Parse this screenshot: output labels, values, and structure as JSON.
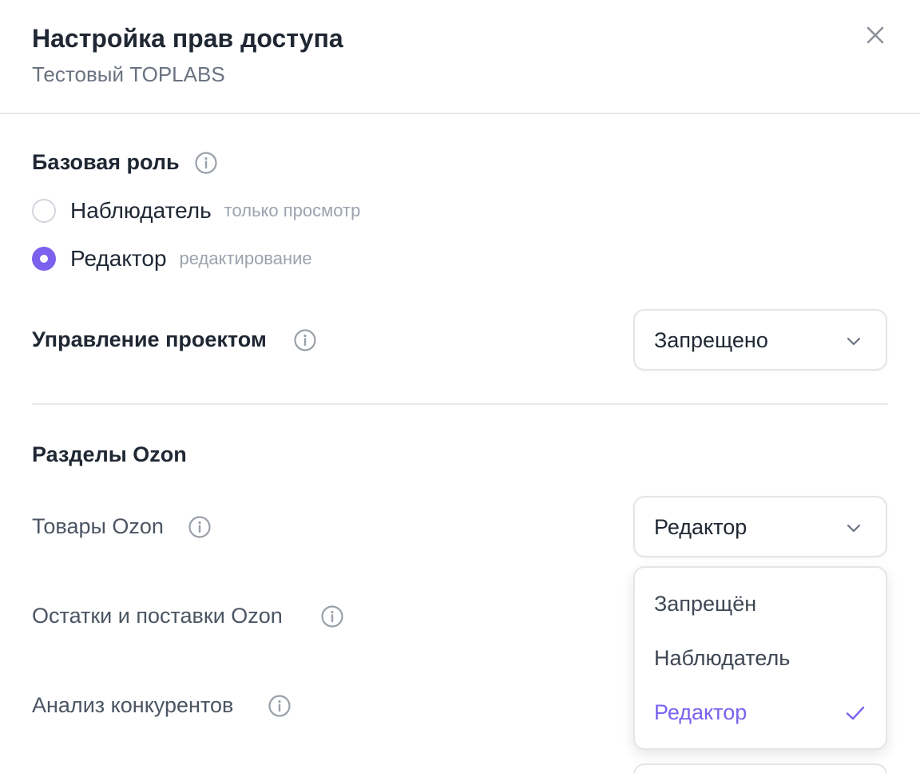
{
  "header": {
    "title": "Настройка прав доступа",
    "subtitle": "Тестовый TOPLABS",
    "close_icon": "close-icon"
  },
  "base_role": {
    "title": "Базовая роль",
    "info_icon": "info-icon",
    "options": [
      {
        "label": "Наблюдатель",
        "hint": "только просмотр",
        "checked": false
      },
      {
        "label": "Редактор",
        "hint": "редактирование",
        "checked": true
      }
    ]
  },
  "project_management": {
    "title": "Управление проектом",
    "value": "Запрещено",
    "icon": "chevron-down-icon"
  },
  "ozon_sections": {
    "title": "Разделы Ozon",
    "rows": [
      {
        "label": "Товары Ozon",
        "value": "Редактор"
      },
      {
        "label": "Остатки и поставки Ozon"
      },
      {
        "label": "Анализ конкурентов"
      }
    ]
  },
  "dropdown": {
    "options": [
      {
        "label": "Запрещён",
        "selected": false
      },
      {
        "label": "Наблюдатель",
        "selected": false
      },
      {
        "label": "Редактор",
        "selected": true
      }
    ],
    "check_icon": "check-icon"
  },
  "colors": {
    "accent": "#7b61ee",
    "text": "#1f2733",
    "muted": "#6b7280",
    "border": "#e3e5e9"
  }
}
